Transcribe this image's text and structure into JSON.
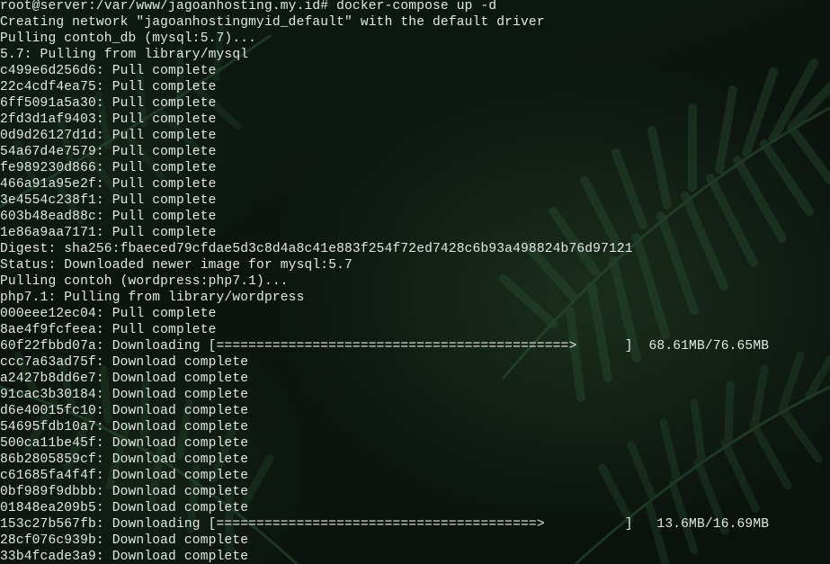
{
  "terminal": {
    "lines": [
      "root@server:/var/www/jagoanhosting.my.id# docker-compose up -d",
      "Creating network \"jagoanhostingmyid_default\" with the default driver",
      "Pulling contoh_db (mysql:5.7)...",
      "5.7: Pulling from library/mysql",
      "c499e6d256d6: Pull complete",
      "22c4cdf4ea75: Pull complete",
      "6ff5091a5a30: Pull complete",
      "2fd3d1af9403: Pull complete",
      "0d9d26127d1d: Pull complete",
      "54a67d4e7579: Pull complete",
      "fe989230d866: Pull complete",
      "466a91a95e2f: Pull complete",
      "3e4554c238f1: Pull complete",
      "603b48ead88c: Pull complete",
      "1e86a9aa7171: Pull complete",
      "Digest: sha256:fbaeced79cfdae5d3c8d4a8c41e883f254f72ed7428c6b93a498824b76d97121",
      "Status: Downloaded newer image for mysql:5.7",
      "Pulling contoh (wordpress:php7.1)...",
      "php7.1: Pulling from library/wordpress",
      "000eee12ec04: Pull complete",
      "8ae4f9fcfeea: Pull complete",
      "60f22fbbd07a: Downloading [============================================>      ]  68.61MB/76.65MB",
      "ccc7a63ad75f: Download complete",
      "a2427b8dd6e7: Download complete",
      "91cac3b30184: Download complete",
      "d6e40015fc10: Download complete",
      "54695fdb10a7: Download complete",
      "500ca11be45f: Download complete",
      "86b2805859cf: Download complete",
      "c61685fa4f4f: Download complete",
      "0bf989f9dbbb: Download complete",
      "01848ea209b5: Download complete",
      "153c27b567fb: Downloading [========================================>          ]   13.6MB/16.69MB",
      "28cf076c939b: Download complete",
      "33b4fcade3a9: Download complete"
    ]
  }
}
